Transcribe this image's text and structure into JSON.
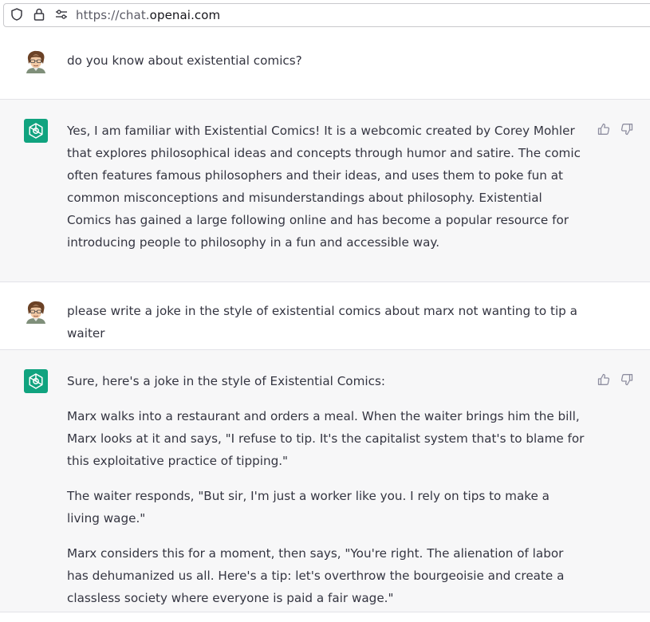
{
  "browser": {
    "url_prefix": "https://chat.",
    "url_domain": "openai.com",
    "icons": [
      "shield-icon",
      "lock-icon",
      "permissions-icon"
    ]
  },
  "messages": [
    {
      "role": "user",
      "text": "do you know about existential comics?"
    },
    {
      "role": "assistant",
      "paragraphs": [
        "Yes, I am familiar with Existential Comics! It is a webcomic created by Corey Mohler that explores philosophical ideas and concepts through humor and satire. The comic often features famous philosophers and their ideas, and uses them to poke fun at common misconceptions and misunderstandings about philosophy. Existential Comics has gained a large following online and has become a popular resource for introducing people to philosophy in a fun and accessible way."
      ]
    },
    {
      "role": "user",
      "text": "please write a joke in the style of existential comics about marx not wanting to tip a waiter"
    },
    {
      "role": "assistant",
      "paragraphs": [
        "Sure, here's a joke in the style of Existential Comics:",
        "Marx walks into a restaurant and orders a meal. When the waiter brings him the bill, Marx looks at it and says, \"I refuse to tip. It's the capitalist system that's to blame for this exploitative practice of tipping.\"",
        "The waiter responds, \"But sir, I'm just a worker like you. I rely on tips to make a living wage.\"",
        "Marx considers this for a moment, then says, \"You're right. The alienation of labor has dehumanized us all. Here's a tip: let's overthrow the bourgeoisie and create a classless society where everyone is paid a fair wage.\""
      ]
    }
  ],
  "colors": {
    "assistant_bg": "#f7f7f8",
    "accent": "#10a37f",
    "text": "#343541"
  }
}
